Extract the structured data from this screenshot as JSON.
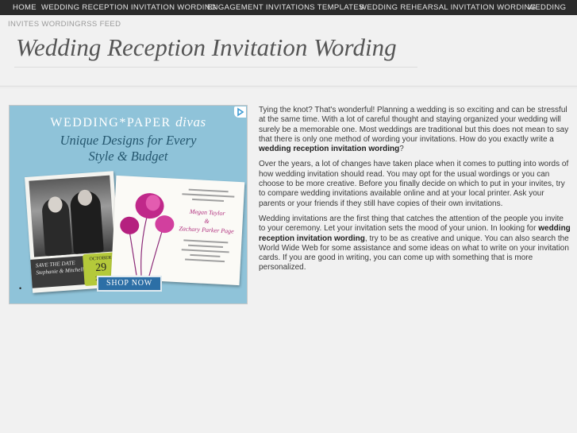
{
  "nav": {
    "top_items": [
      "HOME",
      "WEDDING RECEPTION INVITATION WORDING",
      "ENGAGEMENT INVITATIONS TEMPLATES",
      "WEDDING REHEARSAL INVITATION WORDING",
      "WEDDING"
    ],
    "second_items": [
      "INVITES WORDING",
      "RSS FEED"
    ]
  },
  "header": {
    "title": "Wedding Reception Invitation Wording"
  },
  "ad": {
    "brand_main": "WEDDING",
    "brand_star": "*",
    "brand_paper": "PAPER",
    "brand_divas": "divas",
    "tagline_line1": "Unique Designs for Every",
    "tagline_line2": "Style & Budget",
    "save_text_line1": "SAVE THE DATE",
    "save_text_line2": "Stephanie & Mitchell",
    "save_date_month": "OCTOBER",
    "save_date_day": "29",
    "save_date_year": "2012",
    "invite_name1": "Megan Taylor",
    "invite_and": "&",
    "invite_name2": "Zachary Parker Page",
    "shop_button": "SHOP NOW",
    "bullet": "•",
    "adchoices_icon": "adchoices-icon",
    "colors": {
      "background": "#8fc3d9",
      "tagline": "#24566e",
      "button": "#2c6fa6",
      "accent_lime": "#b4c93a"
    }
  },
  "article": {
    "p1_text": "Tying the knot? That's wonderful! Planning a wedding is so exciting and can be stressful at the same time. With a lot of careful thought and staying organized your wedding will surely be a memorable one. Most weddings are traditional but this does not mean to say that there is only one method of wording your invitations. How do you exactly write a ",
    "p1_bold": "wedding reception invitation wording",
    "p1_end": "?",
    "p2_text": "Over the years, a lot of changes have taken place when it comes to putting into words of how wedding invitation should read. You may opt for the usual wordings or you can choose to be more creative. Before you finally decide on which to put in your invites, try to compare wedding invitations available online and at your local printer. Ask your parents or your friends if they still have copies of their own invitations.",
    "p3_text_a": "Wedding invitations are the first thing that catches the attention of the people you invite to your ceremony. Let your invitation sets the mood of your union. In looking for ",
    "p3_bold": "wedding reception invitation wording",
    "p3_text_b": ", try to be as creative and unique. You can also search the World Wide Web for some assistance and some ideas on what to write on your invitation cards. If you are good in writing, you can come up with something that is more personalized."
  }
}
